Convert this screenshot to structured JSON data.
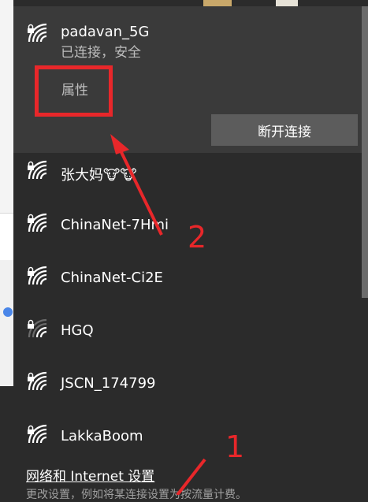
{
  "networks": {
    "connected": {
      "ssid": "padavan_5G",
      "status": "已连接，安全",
      "properties_label": "属性",
      "disconnect_label": "断开连接"
    },
    "list": [
      {
        "ssid": "张大妈🐮🐮",
        "icon": "wifi-secured-icon"
      },
      {
        "ssid": "ChinaNet-7Hmi",
        "icon": "wifi-secured-icon"
      },
      {
        "ssid": "ChinaNet-Ci2E",
        "icon": "wifi-secured-icon"
      },
      {
        "ssid": "HGQ",
        "icon": "wifi-secured-weak-icon"
      },
      {
        "ssid": "JSCN_174799",
        "icon": "wifi-secured-icon"
      },
      {
        "ssid": "LakkaBoom",
        "icon": "wifi-secured-icon"
      }
    ]
  },
  "footer": {
    "settings_link": "网络和 Internet 设置",
    "description": "更改设置，例如将某连接设置为按流量计费。"
  },
  "annotations": {
    "label_1": "1",
    "label_2": "2",
    "color": "#e8272a"
  }
}
